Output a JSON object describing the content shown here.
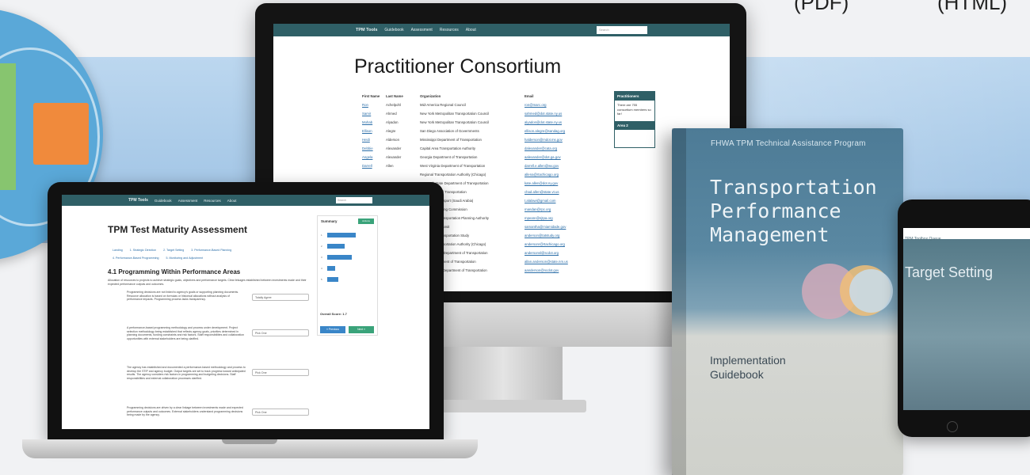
{
  "header_labels": {
    "pdf": "(PDF)",
    "html": "(HTML)"
  },
  "desktop": {
    "nav": {
      "brand": "TPM Tools",
      "items": [
        "Guidebook",
        "Assessment",
        "Resources",
        "About"
      ],
      "search_placeholder": "Search"
    },
    "title": "Practitioner Consortium",
    "table_headers": [
      "First Name",
      "Last Name",
      "Organization",
      "Email"
    ],
    "rows": [
      [
        "Ron",
        "Achelpohl",
        "Mid-America Regional Council",
        "ron@marc.org"
      ],
      [
        "Samir",
        "Ahmed",
        "New York Metropolitan Transportation Council",
        "sahmed@dot.state.ny.us"
      ],
      [
        "Mohab",
        "Alyadon",
        "New York Metropolitan Transportation Council",
        "alyadon@dot.state.ny.us"
      ],
      [
        "Ellison",
        "Alegre",
        "San Diego Association of Governments",
        "ellison.alegre@sandag.org"
      ],
      [
        "Heidi",
        "Alderson",
        "Mississippi Department of Transportation",
        "halderson@mdot.ms.gov"
      ],
      [
        "Debbie",
        "Alexander",
        "Capital Area Transportation Authority",
        "dalexander@cata.org"
      ],
      [
        "Angela",
        "Alexander",
        "Georgia Department of Transportation",
        "aalexander@dot.ga.gov"
      ],
      [
        "Darrell",
        "Allen",
        "West Virginia Department of Transportation",
        "darrell.e.allen@wv.gov"
      ],
      [
        "",
        "",
        "Regional Transportation Authority (Chicago)",
        "allena@rtachicago.org"
      ],
      [
        "",
        "",
        "New York State Department of Transportation",
        "kate.allen@dot.ny.gov"
      ],
      [
        "",
        "",
        "State Agency of Transportation",
        "chad.allen@state.vt.us"
      ],
      [
        "",
        "",
        "Ministry of Transport (Saudi Arabia)",
        "t.alalawi@gmail.com"
      ],
      [
        "",
        "",
        "Regional Planning Commission",
        "mandan@rpc.org"
      ],
      [
        "",
        "",
        "New Jersey Transportation Planning Authority",
        "mpeare@njtpa.org"
      ],
      [
        "",
        "",
        "Miami-Dade Transit",
        "samantha@miamidade.gov"
      ],
      [
        "",
        "",
        "Texas Area Transportation Study",
        "anderson@tatstudy.org"
      ],
      [
        "",
        "",
        "Regional Transportation Authority (Chicago)",
        "andersonr@rtachicago.org"
      ],
      [
        "",
        "",
        "South Carolina Department of Transportation",
        "andersonsl@scdot.org"
      ],
      [
        "",
        "",
        "Mexico Department of Transportation",
        "allan.anderson@state.nm.us"
      ],
      [
        "",
        "",
        "North Carolina Department of Transportation",
        "aanderson@ncdot.gov"
      ]
    ],
    "sidebar": {
      "header": "Practitioners",
      "text": "There are 755 consortium members so far!",
      "area": "Area 2"
    }
  },
  "laptop": {
    "nav": {
      "brand": "TPM Tools",
      "items": [
        "Guidebook",
        "Assessment",
        "Resources",
        "About"
      ],
      "search_placeholder": "Search"
    },
    "title": "TPM Test Maturity Assessment",
    "breadcrumbs": [
      "Landing",
      "1. Strategic Direction",
      "2. Target Setting",
      "3. Performance-Based Planning",
      "4. Performance-Based Programming",
      "5. Monitoring and Adjustment"
    ],
    "section_title": "4.1 Programming Within Performance Areas",
    "section_desc": "Allocation of resources to projects to achieve strategic goals, objectives and performance targets. Clear linkages established between investments made and their expected performance outputs and outcomes.",
    "questions": [
      {
        "text": "Programming decisions are not linked to agency's goals or supporting planning documents. Resource allocation is based on formulas or historical allocations without analysis of performance impacts. Programming process lacks transparency.",
        "value": "Totally Agree"
      },
      {
        "text": "A performance-based programming methodology and process under development. Project selection methodology being established that reflects agency goals, priorities determined in planning documents, funding constraints and risk factors. Staff responsibilities and collaboration opportunities with external stakeholders are being clarified.",
        "value": "Pick One"
      },
      {
        "text": "The agency has established and documented a performance-based methodology and process to develop the STIP and agency budget. Output targets are set to track progress toward anticipated results. The agency considers risk factors in programming and budgeting decisions. Staff responsibilities and external collaboration processes clarified.",
        "value": "Pick One"
      },
      {
        "text": "Programming decisions are driven by a clear linkage between investments made and expected performance outputs and outcomes. External stakeholders understand programming decisions being made by the agency.",
        "value": "Pick One"
      }
    ],
    "summary": {
      "title": "Summary",
      "button": "Actions",
      "overall_label": "Overall Score:",
      "overall_value": "1.7",
      "bars": [
        0.75,
        0.45,
        0.65,
        0.2,
        0.3
      ],
      "prev": "« Previous",
      "next": "Next »"
    }
  },
  "book": {
    "program": "FHWA TPM Technical Assistance Program",
    "title_lines": [
      "Transportation",
      "Performance",
      "Management"
    ],
    "subtitle_lines": [
      "Implementation",
      "Guidebook"
    ]
  },
  "tablet": {
    "queue_label": "TPM Toolbox Queue",
    "heading": "Target Setting"
  },
  "colors": {
    "teal_nav": "#2f5f66",
    "link": "#2b6ea8",
    "bar": "#3a86c8",
    "green": "#3aa37a",
    "book_blue": "#5a88a2"
  }
}
